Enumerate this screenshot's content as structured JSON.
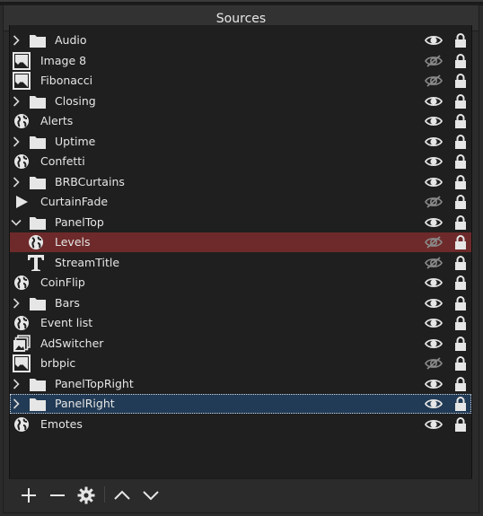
{
  "dock": {
    "title": "Sources"
  },
  "colors": {
    "selected_row": "#6e2a2a",
    "focused_row": "#213a55",
    "icon": "#e6e6e6",
    "hidden_eye": "#8a8a8a"
  },
  "sources": [
    {
      "name": "Audio",
      "type": "folder",
      "expander": "collapsed",
      "visible": true,
      "locked": true
    },
    {
      "name": "Image 8",
      "type": "image",
      "visible": false,
      "locked": true
    },
    {
      "name": "Fibonacci",
      "type": "image",
      "visible": false,
      "locked": true
    },
    {
      "name": "Closing",
      "type": "folder",
      "expander": "collapsed",
      "visible": true,
      "locked": true
    },
    {
      "name": "Alerts",
      "type": "browser",
      "visible": true,
      "locked": true
    },
    {
      "name": "Uptime",
      "type": "folder",
      "expander": "collapsed",
      "visible": true,
      "locked": true
    },
    {
      "name": "Confetti",
      "type": "browser",
      "visible": true,
      "locked": true
    },
    {
      "name": "BRBCurtains",
      "type": "folder",
      "expander": "collapsed",
      "visible": true,
      "locked": true
    },
    {
      "name": "CurtainFade",
      "type": "media",
      "visible": false,
      "locked": true
    },
    {
      "name": "PanelTop",
      "type": "folder",
      "expander": "expanded",
      "visible": true,
      "locked": true
    },
    {
      "name": "Levels",
      "type": "browser",
      "child": true,
      "state": "selected",
      "visible": false,
      "locked": true
    },
    {
      "name": "StreamTitle",
      "type": "text",
      "child": true,
      "visible": false,
      "locked": true
    },
    {
      "name": "CoinFlip",
      "type": "browser",
      "visible": true,
      "locked": true
    },
    {
      "name": "Bars",
      "type": "folder",
      "expander": "collapsed",
      "visible": true,
      "locked": true
    },
    {
      "name": "Event list",
      "type": "browser",
      "visible": true,
      "locked": true
    },
    {
      "name": "AdSwitcher",
      "type": "slideshow",
      "visible": true,
      "locked": true
    },
    {
      "name": "brbpic",
      "type": "image",
      "visible": false,
      "locked": true
    },
    {
      "name": "PanelTopRight",
      "type": "folder",
      "expander": "collapsed",
      "visible": true,
      "locked": true
    },
    {
      "name": "PanelRight",
      "type": "folder",
      "expander": "collapsed",
      "state": "focused",
      "visible": true,
      "locked": true
    },
    {
      "name": "Emotes",
      "type": "browser",
      "visible": true,
      "locked": true
    }
  ],
  "toolbar": {
    "buttons": [
      {
        "name": "add-source-button",
        "icon": "plus-icon"
      },
      {
        "name": "remove-source-button",
        "icon": "minus-icon"
      },
      {
        "name": "source-properties-button",
        "icon": "gear-icon"
      },
      {
        "name": "move-up-button",
        "icon": "chevron-up-icon"
      },
      {
        "name": "move-down-button",
        "icon": "chevron-down-icon"
      }
    ]
  }
}
